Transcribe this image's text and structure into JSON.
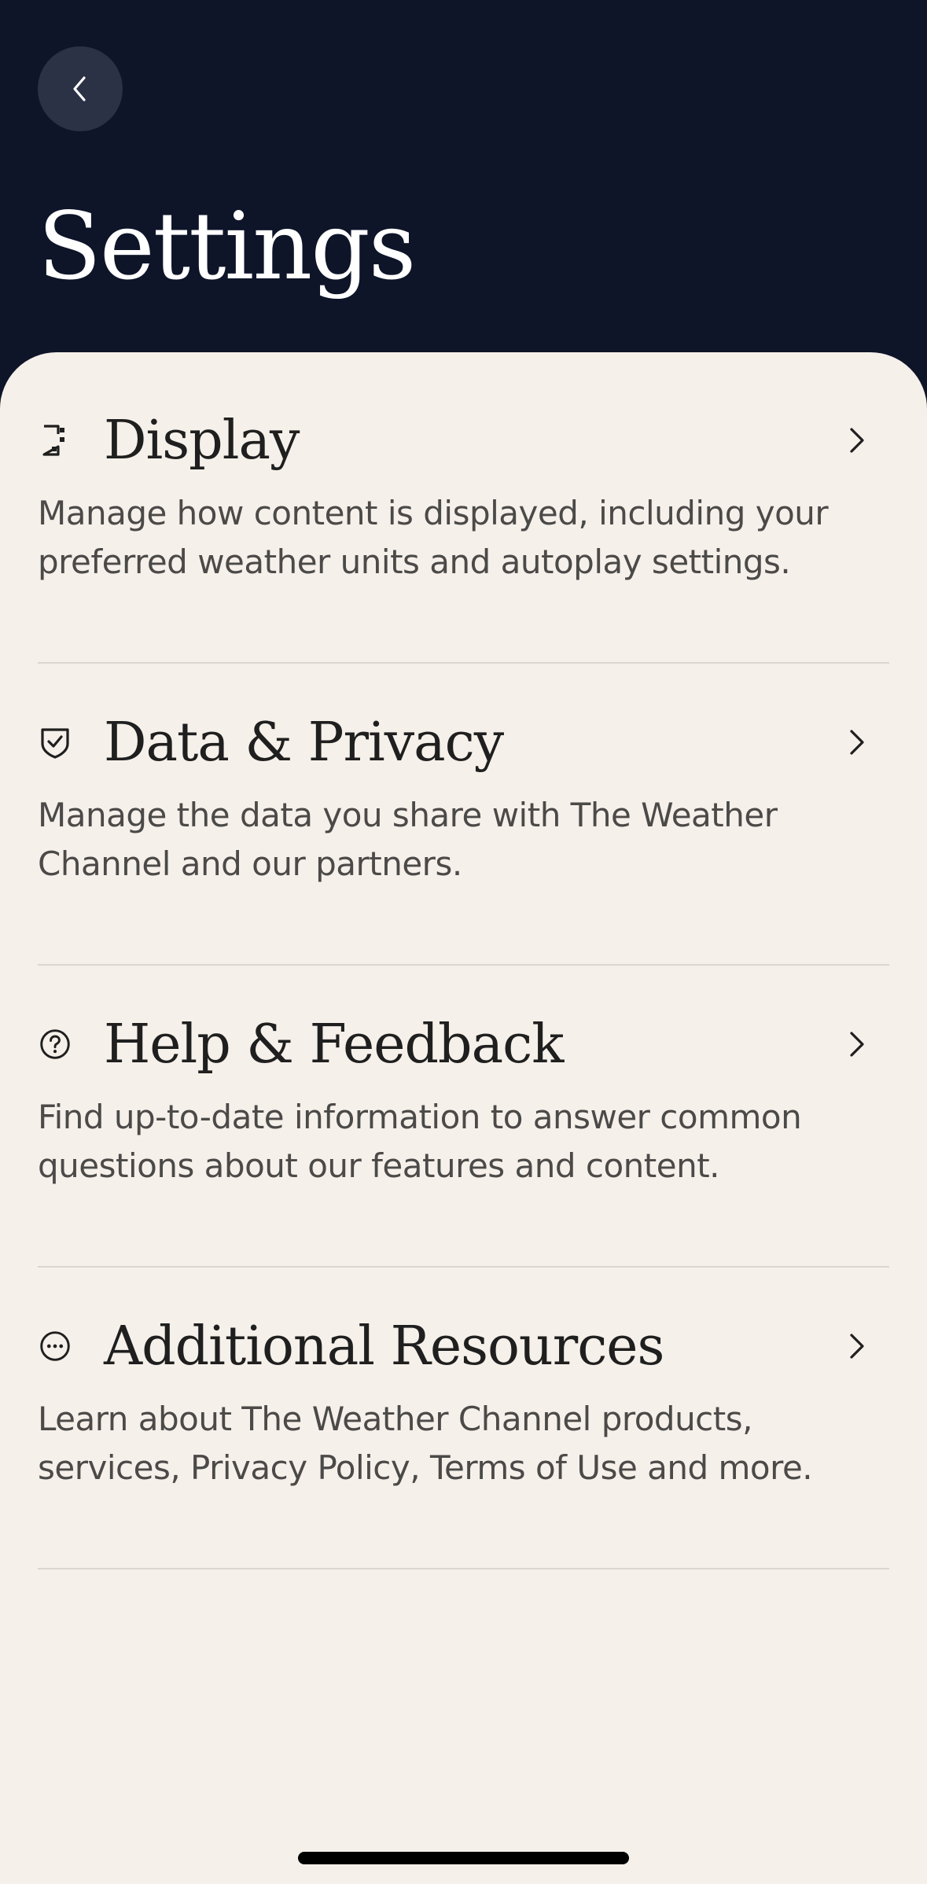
{
  "header": {
    "title": "Settings",
    "back_icon": "chevron-left-icon",
    "background_color": "#0e1529"
  },
  "sheet": {
    "background_color": "#f6f0ea"
  },
  "settings": [
    {
      "title": "Display",
      "description": "Manage how content is displayed, including your preferred weather units and autoplay settings.",
      "icon": "display-icon"
    },
    {
      "title": "Data & Privacy",
      "description": "Manage the data you share with The Weather Channel and our partners.",
      "icon": "shield-check-icon"
    },
    {
      "title": "Help & Feedback",
      "description": "Find up-to-date information to answer common questions about our features and content.",
      "icon": "question-circle-icon"
    },
    {
      "title": "Additional Resources",
      "description": "Learn about The Weather Channel products, services, Privacy Policy, Terms of Use and more.",
      "icon": "more-circle-icon"
    }
  ]
}
